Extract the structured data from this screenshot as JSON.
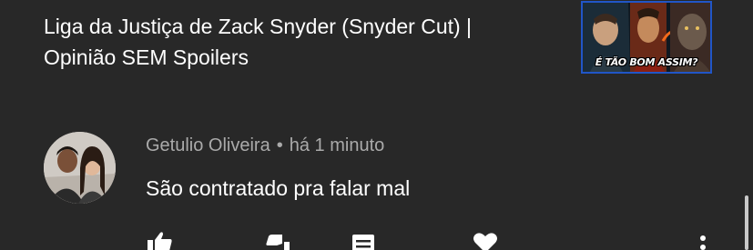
{
  "video": {
    "title_line1": "Liga da Justiça de Zack Snyder (Snyder Cut) |",
    "title_line2": "Opinião SEM Spoilers",
    "thumbnail_caption": "É TÃO BOM ASSIM?"
  },
  "comment": {
    "author": "Getulio Oliveira",
    "separator": "•",
    "time": "há 1 minuto",
    "text": "São contratado pra falar mal"
  },
  "actions": [
    {
      "icon": "thumbs-up-icon"
    },
    {
      "icon": "thumbs-down-icon"
    },
    {
      "icon": "reply-icon"
    },
    {
      "icon": "heart-icon"
    },
    {
      "icon": "more-icon"
    }
  ],
  "colors": {
    "background": "#282828",
    "primary_text": "#ffffff",
    "secondary_text": "#aaaaaa",
    "thumbnail_border": "#2156c7"
  }
}
